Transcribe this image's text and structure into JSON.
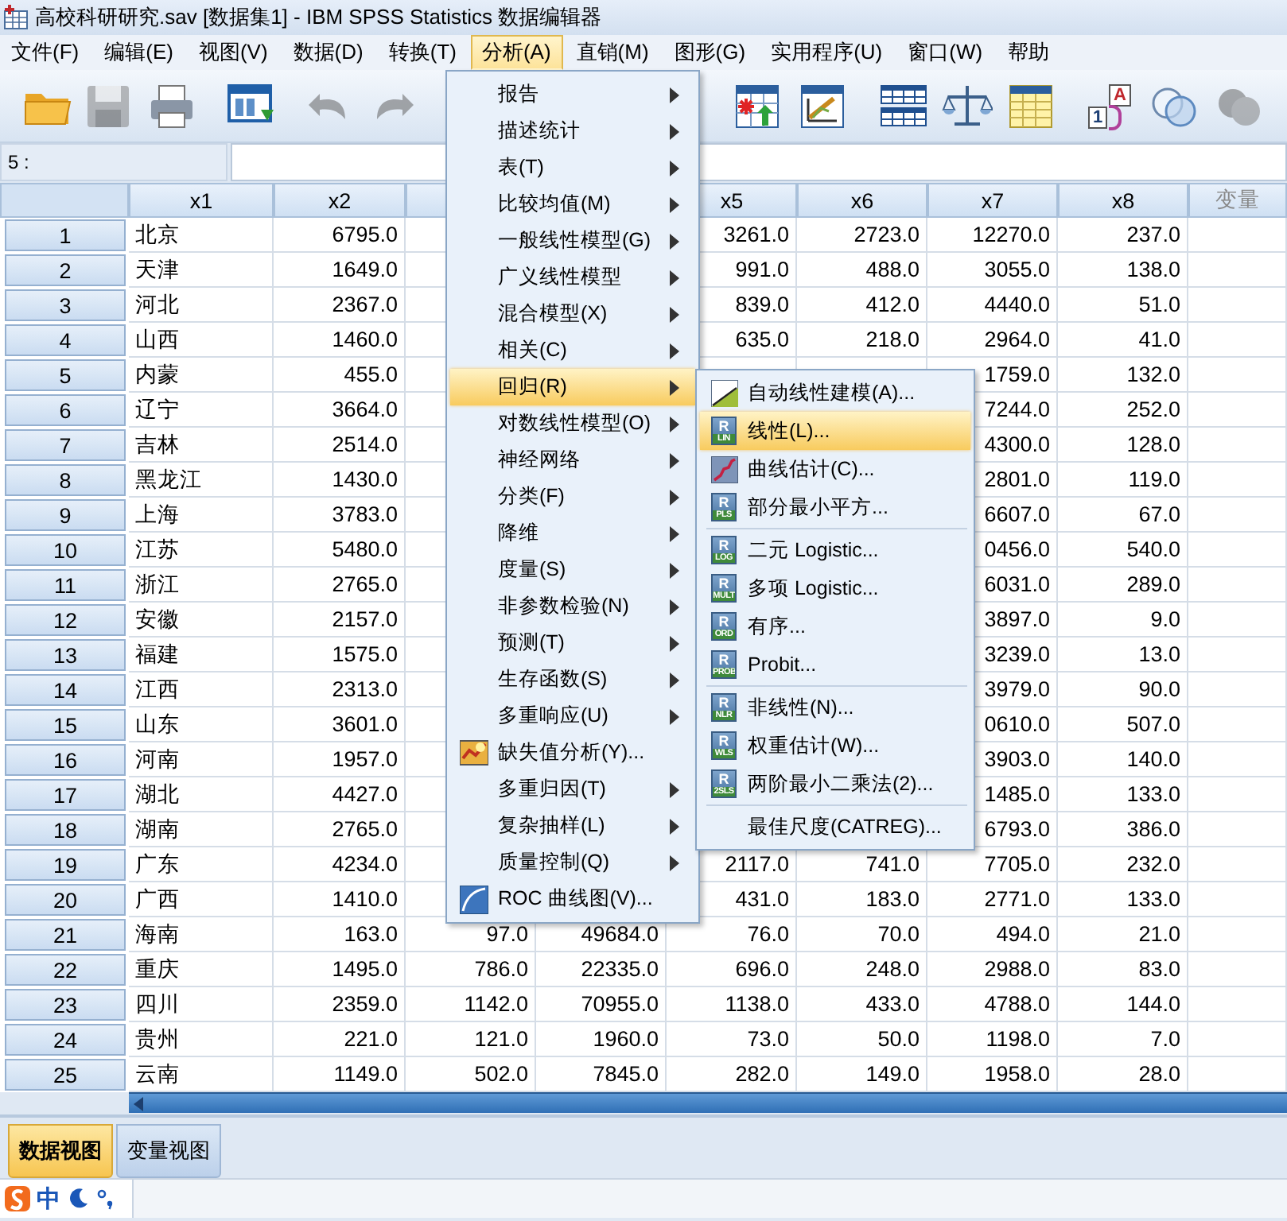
{
  "window": {
    "title": "高校科研研究.sav [数据集1] - IBM SPSS Statistics 数据编辑器"
  },
  "menu_bar": [
    {
      "label": "文件(F)",
      "selected": false
    },
    {
      "label": "编辑(E)",
      "selected": false
    },
    {
      "label": "视图(V)",
      "selected": false
    },
    {
      "label": "数据(D)",
      "selected": false
    },
    {
      "label": "转换(T)",
      "selected": false
    },
    {
      "label": "分析(A)",
      "selected": true
    },
    {
      "label": "直销(M)",
      "selected": false
    },
    {
      "label": "图形(G)",
      "selected": false
    },
    {
      "label": "实用程序(U)",
      "selected": false
    },
    {
      "label": "窗口(W)",
      "selected": false
    },
    {
      "label": "帮助",
      "selected": false
    }
  ],
  "toolbar": [
    {
      "kind": "open",
      "disabled": false
    },
    {
      "kind": "save",
      "disabled": true
    },
    {
      "kind": "print",
      "disabled": false
    },
    {
      "kind": "recall-dialog",
      "disabled": false
    },
    {
      "kind": "undo",
      "disabled": true
    },
    {
      "kind": "redo",
      "disabled": true
    },
    {
      "kind": "insert-cases",
      "disabled": false
    },
    {
      "kind": "chart",
      "disabled": false
    },
    {
      "kind": "split",
      "disabled": false
    },
    {
      "kind": "weight",
      "disabled": false
    },
    {
      "kind": "select",
      "disabled": false
    },
    {
      "kind": "value-labels",
      "disabled": false,
      "letters": [
        "A",
        "1"
      ]
    },
    {
      "kind": "sets",
      "disabled": false
    },
    {
      "kind": "sets-filled",
      "disabled": true
    }
  ],
  "cell_editor": {
    "cell_ref": "5 :"
  },
  "grid": {
    "columns": [
      {
        "label": "x1",
        "kind": "string"
      },
      {
        "label": "x2",
        "kind": "numeric"
      },
      {
        "kind": "numeric"
      },
      {
        "kind": "numeric"
      },
      {
        "label": "x5",
        "kind": "numeric"
      },
      {
        "label": "x6",
        "kind": "numeric"
      },
      {
        "label": "x7",
        "kind": "numeric"
      },
      {
        "label": "x8",
        "kind": "numeric"
      },
      {
        "label": "变量",
        "kind": "empty"
      }
    ],
    "rows": [
      {
        "number": "1",
        "cells": [
          "北京",
          "6795.0",
          null,
          null,
          "3261.0",
          "2723.0",
          "12270.0",
          "237.0"
        ]
      },
      {
        "number": "2",
        "cells": [
          "天津",
          "1649.0",
          null,
          null,
          "991.0",
          "488.0",
          "3055.0",
          "138.0"
        ]
      },
      {
        "number": "3",
        "cells": [
          "河北",
          "2367.0",
          null,
          null,
          "839.0",
          "412.0",
          "4440.0",
          "51.0"
        ]
      },
      {
        "number": "4",
        "cells": [
          "山西",
          "1460.0",
          null,
          null,
          "635.0",
          "218.0",
          "2964.0",
          "41.0"
        ]
      },
      {
        "number": "5",
        "cells": [
          "内蒙",
          "455.0",
          null,
          null,
          null,
          null,
          "1759.0",
          "132.0"
        ]
      },
      {
        "number": "6",
        "cells": [
          "辽宁",
          "3664.0",
          null,
          null,
          null,
          null,
          "7244.0",
          "252.0"
        ]
      },
      {
        "number": "7",
        "cells": [
          "吉林",
          "2514.0",
          null,
          null,
          null,
          null,
          "4300.0",
          "128.0"
        ]
      },
      {
        "number": "8",
        "cells": [
          "黑龙江",
          "1430.0",
          null,
          null,
          null,
          null,
          "2801.0",
          "119.0"
        ]
      },
      {
        "number": "9",
        "cells": [
          "上海",
          "3783.0",
          null,
          null,
          null,
          null,
          "6607.0",
          "67.0"
        ]
      },
      {
        "number": "10",
        "cells": [
          "江苏",
          "5480.0",
          null,
          null,
          null,
          null,
          "0456.0",
          "540.0"
        ]
      },
      {
        "number": "11",
        "cells": [
          "浙江",
          "2765.0",
          null,
          null,
          null,
          null,
          "6031.0",
          "289.0"
        ]
      },
      {
        "number": "12",
        "cells": [
          "安徽",
          "2157.0",
          null,
          null,
          null,
          null,
          "3897.0",
          "9.0"
        ]
      },
      {
        "number": "13",
        "cells": [
          "福建",
          "1575.0",
          null,
          null,
          null,
          null,
          "3239.0",
          "13.0"
        ]
      },
      {
        "number": "14",
        "cells": [
          "江西",
          "2313.0",
          null,
          null,
          null,
          null,
          "3979.0",
          "90.0"
        ]
      },
      {
        "number": "15",
        "cells": [
          "山东",
          "3601.0",
          null,
          null,
          null,
          null,
          "0610.0",
          "507.0"
        ]
      },
      {
        "number": "16",
        "cells": [
          "河南",
          "1957.0",
          null,
          null,
          null,
          null,
          "3903.0",
          "140.0"
        ]
      },
      {
        "number": "17",
        "cells": [
          "湖北",
          "4427.0",
          null,
          null,
          null,
          null,
          "1485.0",
          "133.0"
        ]
      },
      {
        "number": "18",
        "cells": [
          "湖南",
          "2765.0",
          null,
          null,
          null,
          null,
          "6793.0",
          "386.0"
        ]
      },
      {
        "number": "19",
        "cells": [
          "广东",
          "4234.0",
          null,
          null,
          "2117.0",
          "741.0",
          "7705.0",
          "232.0"
        ]
      },
      {
        "number": "20",
        "cells": [
          "广西",
          "1410.0",
          null,
          null,
          "431.0",
          "183.0",
          "2771.0",
          "133.0"
        ]
      },
      {
        "number": "21",
        "cells": [
          "海南",
          "163.0",
          "97.0",
          "49684.0",
          "76.0",
          "70.0",
          "494.0",
          "21.0"
        ]
      },
      {
        "number": "22",
        "cells": [
          "重庆",
          "1495.0",
          "786.0",
          "22335.0",
          "696.0",
          "248.0",
          "2988.0",
          "83.0"
        ]
      },
      {
        "number": "23",
        "cells": [
          "四川",
          "2359.0",
          "1142.0",
          "70955.0",
          "1138.0",
          "433.0",
          "4788.0",
          "144.0"
        ]
      },
      {
        "number": "24",
        "cells": [
          "贵州",
          "221.0",
          "121.0",
          "1960.0",
          "73.0",
          "50.0",
          "1198.0",
          "7.0"
        ]
      },
      {
        "number": "25",
        "cells": [
          "云南",
          "1149.0",
          "502.0",
          "7845.0",
          "282.0",
          "149.0",
          "1958.0",
          "28.0"
        ]
      }
    ]
  },
  "analyze_menu": {
    "items": [
      {
        "label": "报告",
        "submenu": true,
        "selected": false
      },
      {
        "label": "描述统计",
        "submenu": true,
        "selected": false
      },
      {
        "label": "表(T)",
        "submenu": true,
        "selected": false
      },
      {
        "label": "比较均值(M)",
        "submenu": true,
        "selected": false
      },
      {
        "label": "一般线性模型(G)",
        "submenu": true,
        "selected": false
      },
      {
        "label": "广义线性模型",
        "submenu": true,
        "selected": false
      },
      {
        "label": "混合模型(X)",
        "submenu": true,
        "selected": false
      },
      {
        "label": "相关(C)",
        "submenu": true,
        "selected": false
      },
      {
        "label": "回归(R)",
        "submenu": true,
        "selected": true
      },
      {
        "label": "对数线性模型(O)",
        "submenu": true,
        "selected": false
      },
      {
        "label": "神经网络",
        "submenu": true,
        "selected": false
      },
      {
        "label": "分类(F)",
        "submenu": true,
        "selected": false
      },
      {
        "label": "降维",
        "submenu": true,
        "selected": false
      },
      {
        "label": "度量(S)",
        "submenu": true,
        "selected": false
      },
      {
        "label": "非参数检验(N)",
        "submenu": true,
        "selected": false
      },
      {
        "label": "预测(T)",
        "submenu": true,
        "selected": false
      },
      {
        "label": "生存函数(S)",
        "submenu": true,
        "selected": false
      },
      {
        "label": "多重响应(U)",
        "submenu": true,
        "selected": false
      },
      {
        "label": "缺失值分析(Y)...",
        "submenu": false,
        "selected": false,
        "kind": "missing-values"
      },
      {
        "label": "多重归因(T)",
        "submenu": true,
        "selected": false
      },
      {
        "label": "复杂抽样(L)",
        "submenu": true,
        "selected": false
      },
      {
        "label": "质量控制(Q)",
        "submenu": true,
        "selected": false
      },
      {
        "label": "ROC 曲线图(V)...",
        "submenu": false,
        "selected": false,
        "kind": "roc"
      }
    ]
  },
  "regression_submenu": {
    "items": [
      {
        "kind": "item",
        "label": "自动线性建模(A)...",
        "selected": false,
        "icon": {
          "kind": "auto-linear"
        }
      },
      {
        "kind": "item",
        "label": "线性(L)...",
        "selected": true,
        "icon": {
          "kind": "r-box",
          "letter": "R",
          "caption": "LIN"
        }
      },
      {
        "kind": "item",
        "label": "曲线估计(C)...",
        "selected": false,
        "icon": {
          "kind": "curve"
        }
      },
      {
        "kind": "item",
        "label": "部分最小平方...",
        "selected": false,
        "icon": {
          "kind": "r-box",
          "letter": "R",
          "caption": "PLS"
        }
      },
      {
        "kind": "separator"
      },
      {
        "kind": "item",
        "label": "二元 Logistic...",
        "selected": false,
        "icon": {
          "kind": "r-box",
          "letter": "R",
          "caption": "LOG"
        }
      },
      {
        "kind": "item",
        "label": "多项 Logistic...",
        "selected": false,
        "icon": {
          "kind": "r-box",
          "letter": "R",
          "caption": "MULT"
        }
      },
      {
        "kind": "item",
        "label": "有序...",
        "selected": false,
        "icon": {
          "kind": "r-box",
          "letter": "R",
          "caption": "ORD"
        }
      },
      {
        "kind": "item",
        "label": "Probit...",
        "selected": false,
        "icon": {
          "kind": "r-box",
          "letter": "R",
          "caption": "PROB"
        }
      },
      {
        "kind": "separator"
      },
      {
        "kind": "item",
        "label": "非线性(N)...",
        "selected": false,
        "icon": {
          "kind": "r-box",
          "letter": "R",
          "caption": "NLR"
        }
      },
      {
        "kind": "item",
        "label": "权重估计(W)...",
        "selected": false,
        "icon": {
          "kind": "r-box",
          "letter": "R",
          "caption": "WLS"
        }
      },
      {
        "kind": "item",
        "label": "两阶最小二乘法(2)...",
        "selected": false,
        "icon": {
          "kind": "r-box",
          "letter": "R",
          "caption": "2SLS"
        }
      },
      {
        "kind": "separator"
      },
      {
        "kind": "item",
        "label": "最佳尺度(CATREG)...",
        "selected": false
      }
    ]
  },
  "view_tabs": [
    {
      "label": "数据视图",
      "selected": true
    },
    {
      "label": "变量视图",
      "selected": false
    }
  ],
  "status_bar": {
    "ime_mode": "中"
  }
}
